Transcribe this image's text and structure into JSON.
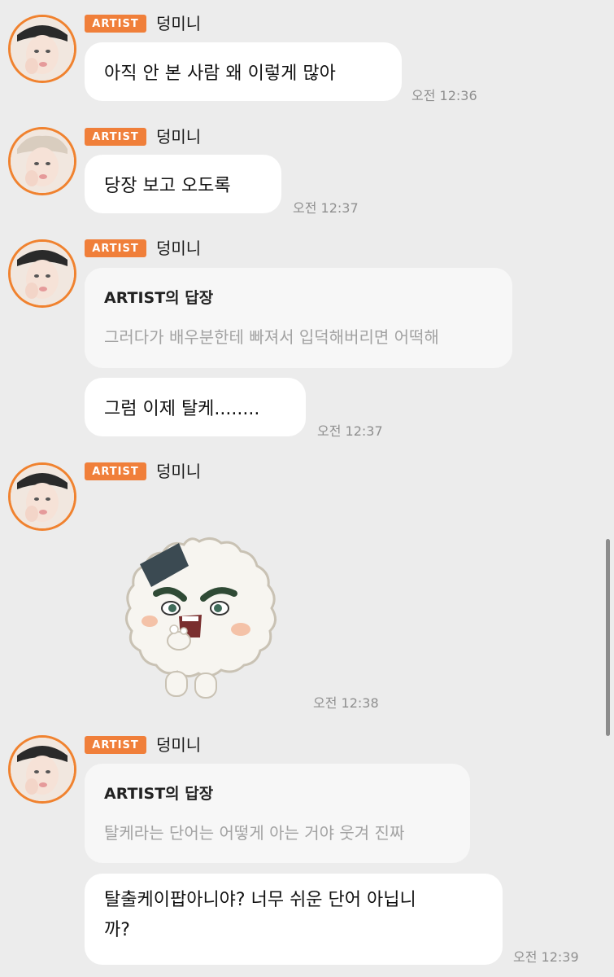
{
  "messages": [
    {
      "badge": "ARTIST",
      "name": "덩미니",
      "text": "아직 안 본 사람 왜 이렇게 많아",
      "time": "오전 12:36"
    },
    {
      "badge": "ARTIST",
      "name": "덩미니",
      "text": "당장 보고 오도록",
      "time": "오전 12:37"
    },
    {
      "badge": "ARTIST",
      "name": "덩미니",
      "reply_title": "ARTIST의 답장",
      "reply_text": "그러다가 배우분한테 빠져서 입덕해버리면 어떡해",
      "text": "그럼 이제 탈케........",
      "time": "오전 12:37"
    },
    {
      "badge": "ARTIST",
      "name": "덩미니",
      "sticker": "rice-ball-character-sticker",
      "time": "오전 12:38"
    },
    {
      "badge": "ARTIST",
      "name": "덩미니",
      "reply_title": "ARTIST의 답장",
      "reply_text": "탈케라는 단어는 어떻게 아는 거야 웃겨 진짜",
      "text_line1": "탈출케이팝아니야? 너무 쉬운 단어 아닙니",
      "text_line2": "까?",
      "time": "오전 12:39"
    }
  ],
  "colors": {
    "accent": "#f07f3a",
    "background": "#ececec",
    "bubble": "#ffffff"
  }
}
